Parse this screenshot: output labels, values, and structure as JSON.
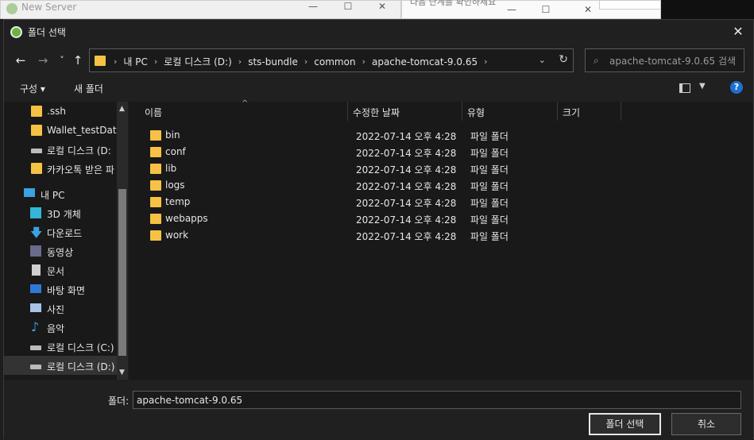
{
  "background": {
    "window1_title": "New Server",
    "window2_text": "다음 단계를 확인하세요"
  },
  "dialog": {
    "title": "폴더 선택",
    "close_glyph": "✕"
  },
  "nav": {
    "back": "←",
    "forward": "→",
    "recent": "˅",
    "up": "↑",
    "breadcrumbs": [
      "내 PC",
      "로컬 디스크 (D:)",
      "sts-bundle",
      "common",
      "apache-tomcat-9.0.65"
    ],
    "search_placeholder": "apache-tomcat-9.0.65 검색"
  },
  "toolbar": {
    "organize": "구성 ▾",
    "new_folder": "새 폴더",
    "help": "?"
  },
  "sidebar": {
    "items": [
      {
        "label": ".ssh",
        "icon": "folder-icon"
      },
      {
        "label": "Wallet_testDataE",
        "icon": "folder-icon"
      },
      {
        "label": "로컬 디스크 (D:",
        "icon": "drive-icon"
      },
      {
        "label": "카카오톡 받은 파",
        "icon": "folder-icon"
      },
      {
        "label": "내 PC",
        "icon": "pc-icon"
      },
      {
        "label": "3D 개체",
        "icon": "3d-objects-icon"
      },
      {
        "label": "다운로드",
        "icon": "download-icon"
      },
      {
        "label": "동영상",
        "icon": "video-icon"
      },
      {
        "label": "문서",
        "icon": "document-icon"
      },
      {
        "label": "바탕 화면",
        "icon": "desktop-icon"
      },
      {
        "label": "사진",
        "icon": "picture-icon"
      },
      {
        "label": "음악",
        "icon": "music-icon"
      },
      {
        "label": "로컬 디스크 (C:)",
        "icon": "drive-icon"
      },
      {
        "label": "로컬 디스크 (D:)",
        "icon": "drive-icon"
      }
    ]
  },
  "columns": {
    "name": "이름",
    "modified": "수정한 날짜",
    "type": "유형",
    "size": "크기"
  },
  "files": [
    {
      "name": "bin",
      "modified": "2022-07-14 오후 4:28",
      "type": "파일 폴더"
    },
    {
      "name": "conf",
      "modified": "2022-07-14 오후 4:28",
      "type": "파일 폴더"
    },
    {
      "name": "lib",
      "modified": "2022-07-14 오후 4:28",
      "type": "파일 폴더"
    },
    {
      "name": "logs",
      "modified": "2022-07-14 오후 4:28",
      "type": "파일 폴더"
    },
    {
      "name": "temp",
      "modified": "2022-07-14 오후 4:28",
      "type": "파일 폴더"
    },
    {
      "name": "webapps",
      "modified": "2022-07-14 오후 4:28",
      "type": "파일 폴더"
    },
    {
      "name": "work",
      "modified": "2022-07-14 오후 4:28",
      "type": "파일 폴더"
    }
  ],
  "footer": {
    "folder_label": "폴더:",
    "folder_value": "apache-tomcat-9.0.65",
    "select_button": "폴더 선택",
    "cancel_button": "취소"
  },
  "colors": {
    "folder": "#f5c243",
    "selection": "#333333",
    "help_blue": "#1e6fd0"
  }
}
